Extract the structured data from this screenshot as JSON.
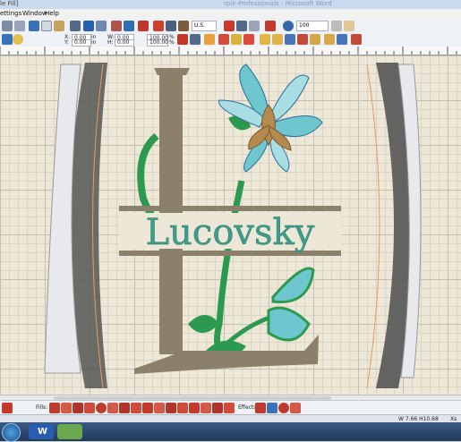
{
  "title_bar": {
    "doc_partial": "le Fill]",
    "center_partial": "rple-Professionals - Microsoft Word"
  },
  "menu": {
    "partial_first": "ettings",
    "window": "Window",
    "help": "Help"
  },
  "toolbar": {
    "units": "U.S.",
    "zoom": "100",
    "x_label": "X:",
    "x_value": "0.00",
    "x_unit": "in",
    "y_label": "Y:",
    "y_value": "0.00",
    "y_unit": "in",
    "w_label": "W:",
    "w_value": "0.00",
    "h_label": "H:",
    "h_value": "0.00",
    "pct1": "100.00",
    "pct2": "100.00",
    "pct_sign": "%"
  },
  "fills_label": "Fills:",
  "effects_label": "Effects:",
  "design_text": "Lucovsky",
  "status_text": "W 7.66 H10.68",
  "status_partial": "Xs",
  "taskbar": {
    "word": "W"
  },
  "colors": {
    "thread_taupe": "#8b806a",
    "thread_green": "#2c9a4e",
    "thread_aqua": "#6ec6cf",
    "thread_aqua_light": "#a9dde4",
    "thread_tan": "#b58a4f",
    "thread_blue_dark": "#2b6f9b",
    "hoop_dark": "#555555"
  }
}
